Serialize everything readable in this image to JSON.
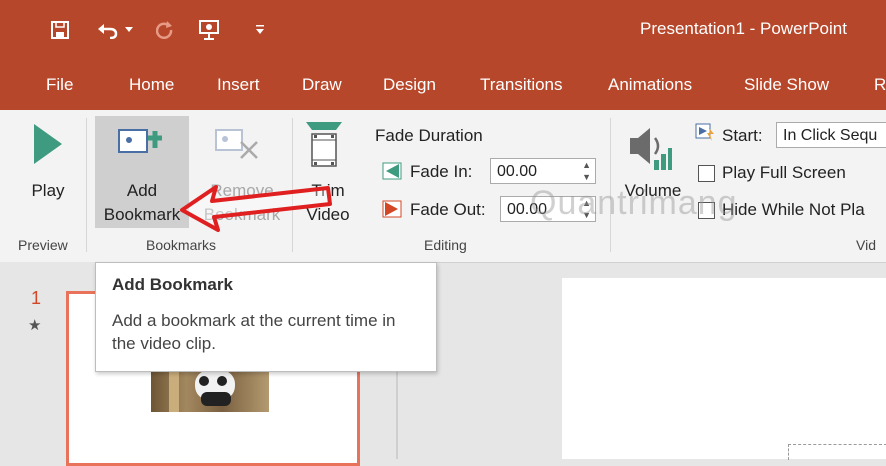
{
  "window": {
    "title": "Presentation1 - PowerPoint"
  },
  "menu": {
    "tabs": [
      "File",
      "Home",
      "Insert",
      "Draw",
      "Design",
      "Transitions",
      "Animations",
      "Slide Show",
      "R"
    ]
  },
  "ribbon": {
    "preview": {
      "play_label": "Play",
      "group_label": "Preview"
    },
    "bookmarks": {
      "add_line1": "Add",
      "add_line2": "Bookmark",
      "remove_line1": "Remove",
      "remove_line2": "Bookmark",
      "group_label": "Bookmarks"
    },
    "editing": {
      "trim_line1": "Trim",
      "trim_line2": "Video",
      "fade_duration_label": "Fade Duration",
      "fade_in_label": "Fade In:",
      "fade_in_value": "00.00",
      "fade_out_label": "Fade Out:",
      "fade_out_value": "00.00",
      "group_label": "Editing"
    },
    "video_options": {
      "volume_label": "Volume",
      "start_label": "Start:",
      "start_value": "In Click Sequ",
      "play_full_screen_label": "Play Full Screen",
      "hide_label": "Hide While Not Pla",
      "group_label": "Vid"
    }
  },
  "slides": {
    "number": "1",
    "star": "★"
  },
  "tooltip": {
    "title": "Add Bookmark",
    "description": "Add a bookmark at the current time in the video clip."
  },
  "watermark": "Quantrimang",
  "colors": {
    "title_bar": "#b7472a",
    "ribbon": "#f3f3f3",
    "accent_arrow": "#e02020",
    "thumb_border": "#e8735a"
  }
}
